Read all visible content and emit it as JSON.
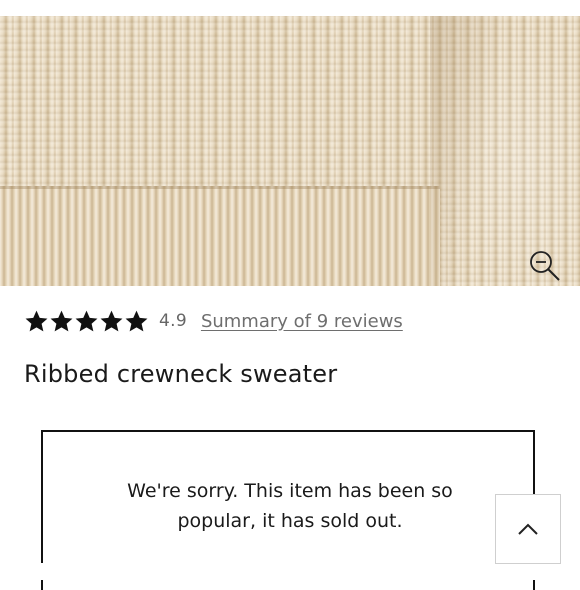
{
  "product": {
    "image_alt": "Ribbed crewneck sweater knit close-up",
    "title": "Ribbed crewneck sweater"
  },
  "rating": {
    "stars": 5,
    "value": "4.9",
    "reviews_link": "Summary of 9 reviews"
  },
  "availability": {
    "message_line1": "We're sorry. This item has been so",
    "message_line2": "popular, it has sold out."
  },
  "icons": {
    "zoom": "zoom-out-magnifier-icon",
    "back_to_top": "chevron-up-icon",
    "star": "star-filled-icon"
  },
  "colors": {
    "star": "#111111",
    "link": "#6e6e6e",
    "border": "#111111"
  }
}
